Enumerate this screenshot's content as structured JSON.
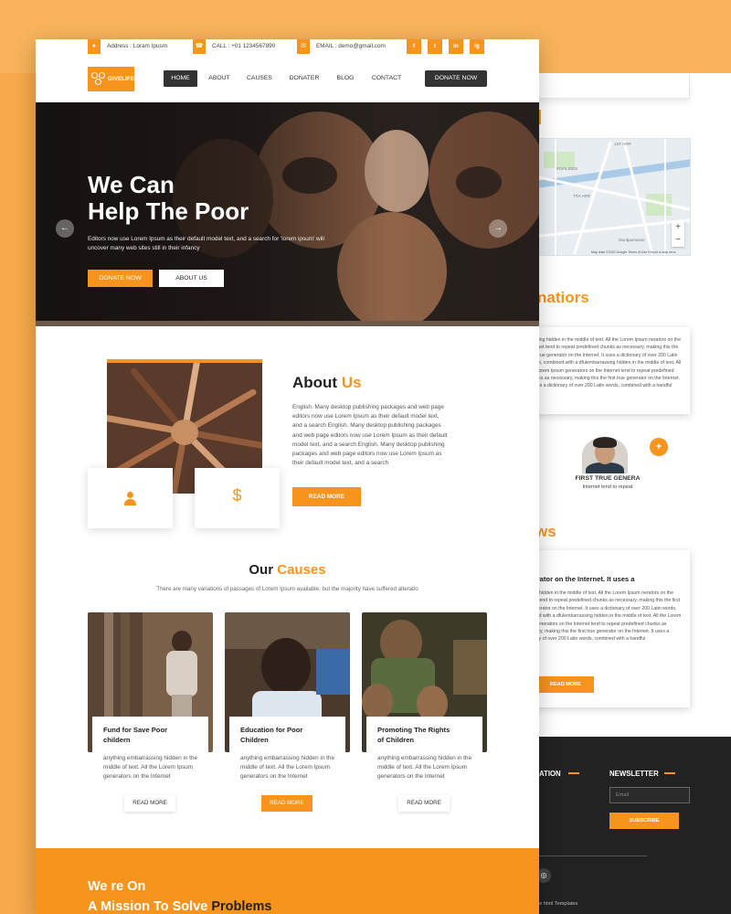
{
  "topbar": {
    "address": "Address : Loram Ipusm",
    "call": "CALL : +01 1234567890",
    "email": "EMAIL : demo@gmail.com",
    "social": [
      "f",
      "t",
      "in",
      "ig"
    ]
  },
  "brand": {
    "name": "GIVELIFE"
  },
  "nav": {
    "items": [
      "HOME",
      "ABOUT",
      "CAUSES",
      "DONATER",
      "BLOG",
      "CONTACT"
    ],
    "donate_label": "DONATE NOW"
  },
  "hero": {
    "title_line1": "We Can",
    "title_line2": "Help The Poor",
    "subtitle": "Editors now use Lorem Ipsum as their default model text, and a search for 'lorem ipsum' will uncover many web sites still in their infancy",
    "btn_donate": "DONATE NOW",
    "btn_about": "ABOUT US"
  },
  "about": {
    "title_a": "About ",
    "title_b": "Us",
    "text": "English. Many desktop publishing packages and web page editors now use Lorem Ipsum as their default model text, and a search English. Many desktop publishing packages and web page editors now use Lorem Ipsum as their default model text, and a search English. Many desktop publishing packages and web page editors now use Lorem Ipsum as their default model text, and a search",
    "btn": "READ MORE",
    "dollar": "$"
  },
  "causes": {
    "title_a": "Our ",
    "title_b": "Causes",
    "subtitle": "There are many variations of passages of Lorem Ipsum available, but the majority have suffered alteratio",
    "items": [
      {
        "title_l1": "Fund for Save Poor",
        "title_l2": "childern",
        "desc": "anything embarrassing hidden in the middle of text. All the Lorem Ipsum generators on the Internet",
        "btn": "READ MORE"
      },
      {
        "title_l1": "Education for Poor",
        "title_l2": "Children",
        "desc": "anything embarrassing hidden in the middle of text. All the Lorem Ipsum generators on the Internet",
        "btn": "READ MORE"
      },
      {
        "title_l1": "Promoting The Rights",
        "title_l2": "of Children",
        "desc": "anything embarrassing hidden in the middle of text. All the Lorem Ipsum generators on the Internet",
        "btn": "READ MORE"
      }
    ]
  },
  "mission": {
    "line1": "We re On",
    "line2_a": "A Mission To Solve ",
    "line2_b": "Problems"
  },
  "back": {
    "map_labels": [
      "1ST ARR",
      "INVALIDES",
      "7TH ARR",
      "Montparnasse"
    ],
    "map_footer": "Map data ©2020 Google   Terms of Use   Report a map error",
    "zoom_in": "+",
    "zoom_out": "−",
    "donations_title": "natiors",
    "donation_text": "rrassing hidden in the middle of text. All the Lorem Ipsum nerators on the Internet tend to repeat predefined chunks as necessary, making this the first true generator on the Internet. It uses a dictionary of over 200 Latin words, combined with a dfulembarrassing hidden in the middle of text. All the Lorem Ipsum generators on the Internet tend to repeat predefined chunks as necessary, making this the first true generator on the Internet. It uses a dictionary of over 200 Latin words, combined with a handful",
    "person_name": "FIRST TRUE GENERA",
    "person_role": "Internet tend to repeat",
    "plus": "+",
    "news_title": "ws",
    "news_card_title": "generator on the Internet. It uses a",
    "news_card_text": "rrassing hidden in the middle of text. All the Lorem Ipsum nerators on the Internet tend to repeat predefined chunks as necessary, making this the first true generator on the Internet. It uses a dictionary of over 200 Latin words, combined with a dfulembarrassing hidden in the middle of text. All the Lorem Ipsum generators on the Internet tend to repeat predefined chunks as necessary, making this the first true generator on the Internet. It uses a dictionary of over 200 Latin words, combined with a handful",
    "news_btn": "READ MORE",
    "footer_info": "ATION",
    "footer_newsletter": "NEWSLETTER",
    "email_placeholder": "Email",
    "subscribe": "SUBSCRIBE",
    "credits": "ee html Templates"
  },
  "colors": {
    "accent": "#f7941d",
    "dark": "#333333",
    "footer": "#222222"
  }
}
